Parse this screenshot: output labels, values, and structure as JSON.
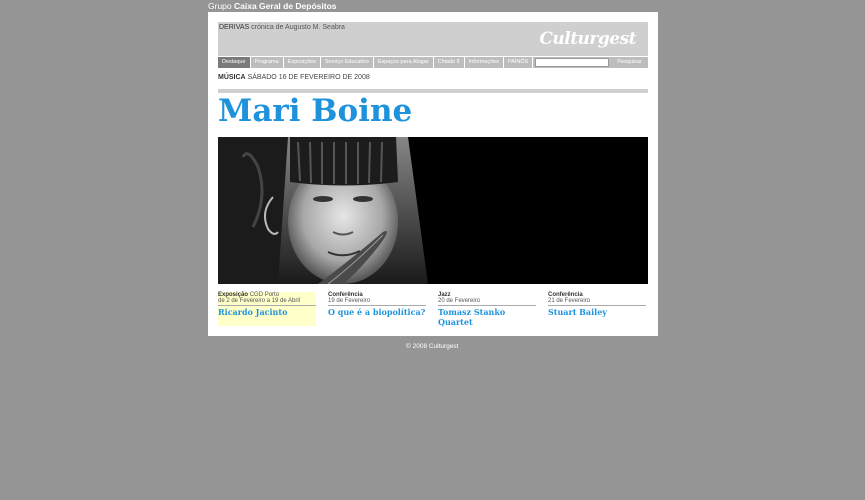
{
  "header": {
    "group_prefix": "Grupo",
    "group_name": "Caixa Geral de Depósitos"
  },
  "banner": {
    "derivas_label": "DERIVAS",
    "derivas_text": "crónica de Augusto M. Seabra",
    "logo": "Culturgest"
  },
  "nav": {
    "items": [
      "Destaque",
      "Programa",
      "Exposições",
      "Serviço Educativo",
      "Espaços para Alugar",
      "Chiado 8",
      "Informações",
      "PAINÓS"
    ],
    "search_placeholder": "",
    "search_button": "Pesquisar"
  },
  "event": {
    "category": "MÚSICA",
    "date": "SÁBADO 16 DE FEVEREIRO DE 2008",
    "title": "Mari Boine"
  },
  "related": [
    {
      "category": "Exposição",
      "place": "CGD Porto",
      "date": "de 2 de Fevereiro a 19 de Abril",
      "title": "Ricardo Jacinto"
    },
    {
      "category": "Conferência",
      "place": "",
      "date": "19 de Fevereiro",
      "title": "O que é a biopolítica?"
    },
    {
      "category": "Jazz",
      "place": "",
      "date": "20 de Fevereiro",
      "title": "Tomasz Stanko Quartet"
    },
    {
      "category": "Conferência",
      "place": "",
      "date": "21 de Fevereiro",
      "title": "Stuart Bailey"
    }
  ],
  "footer": {
    "copyright": "© 2008 Culturgest"
  },
  "colors": {
    "background": "#959595",
    "accent": "#1e93dc",
    "highlight": "#ffffc9"
  }
}
